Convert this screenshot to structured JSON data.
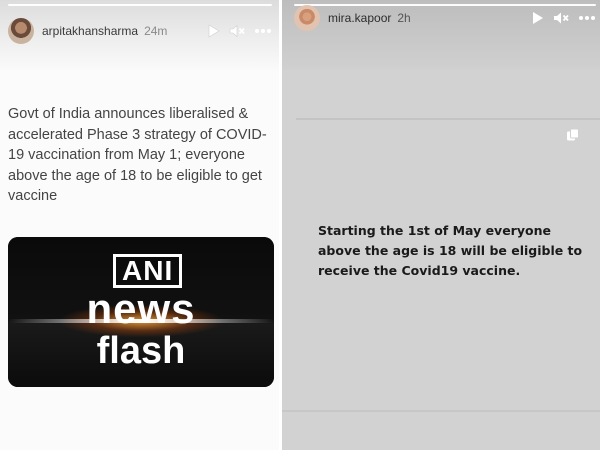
{
  "left_story": {
    "username": "arpitakhansharma",
    "time": "24m",
    "news_text": "Govt of India announces liberalised & accelerated Phase 3 strategy of COVID-19 vaccination from May 1; everyone above the age of 18 to be eligible to get vaccine",
    "image": {
      "logo": "ANI",
      "word1": "news",
      "word2": "flash"
    }
  },
  "right_story": {
    "username": "mira.kapoor",
    "time": "2h",
    "message": "Starting the 1st of May everyone above the age is 18 will be eligible to receive the Covid19 vaccine."
  },
  "icons": [
    "play-icon",
    "mute-icon",
    "more-options-icon",
    "copy-icon"
  ],
  "colors": {
    "left_background": "#fbfbfb",
    "right_background": "#d2d2d2",
    "news_card": "#080808",
    "flare": "#ffaa3c"
  }
}
